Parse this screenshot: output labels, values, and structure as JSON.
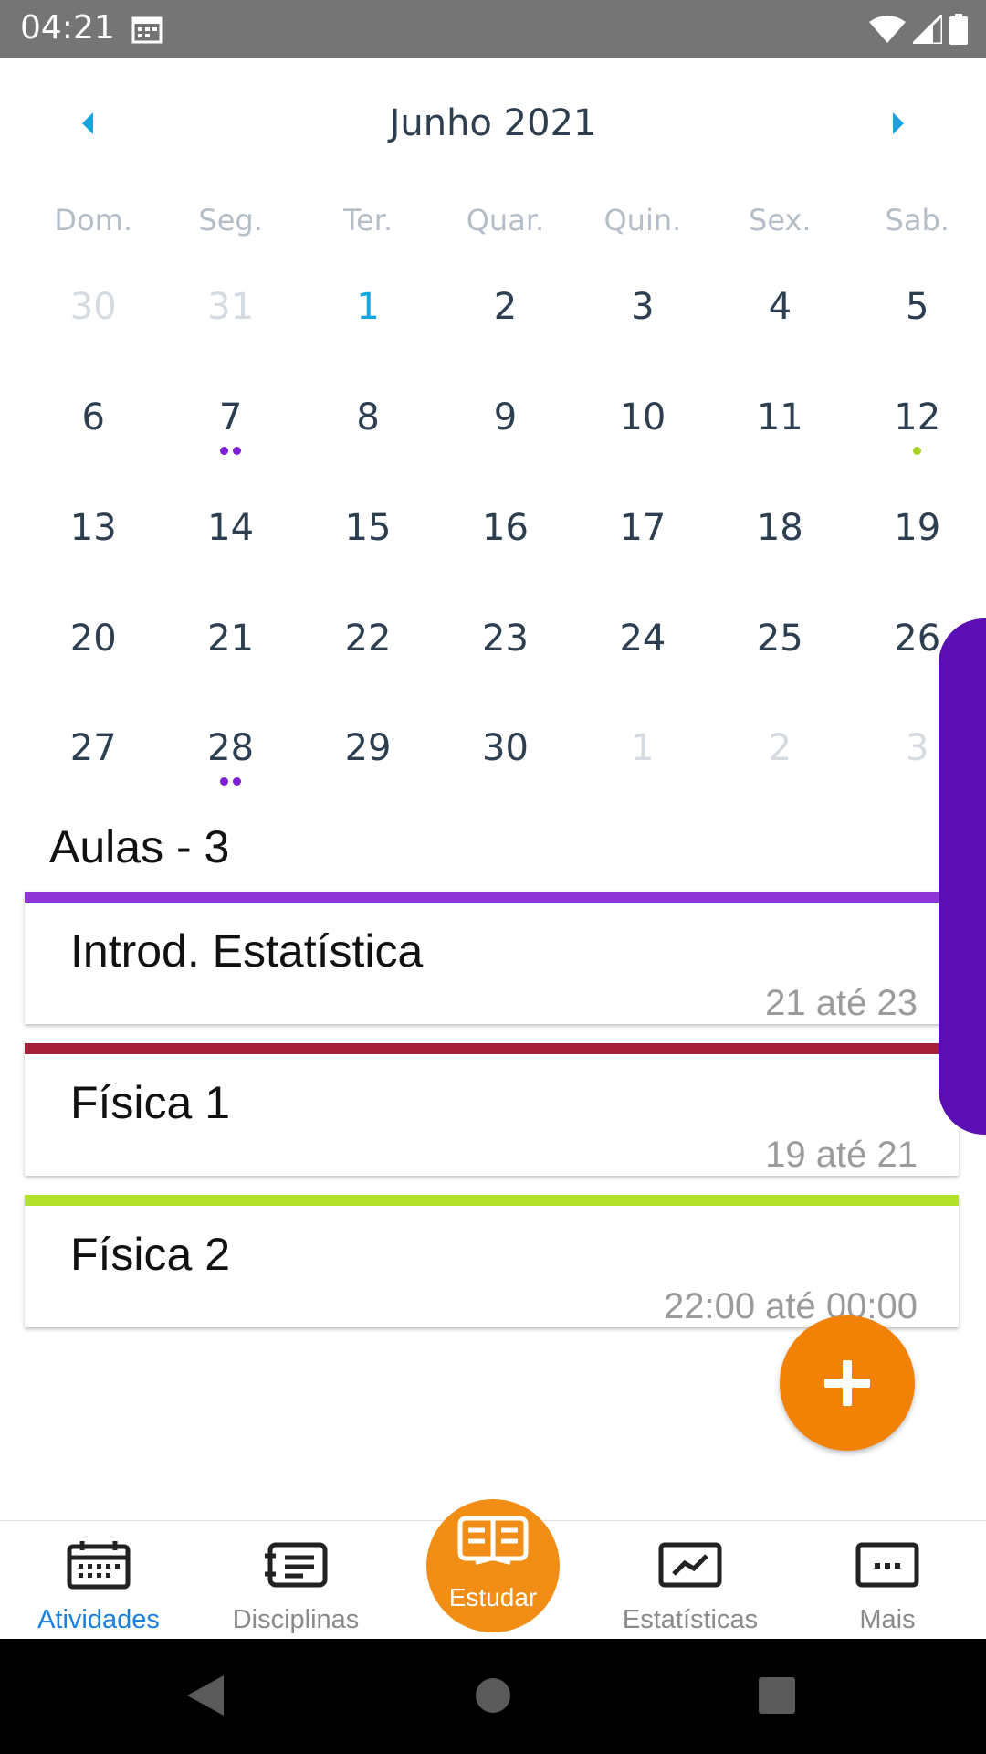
{
  "status_bar": {
    "time": "04:21"
  },
  "calendar": {
    "month_title": "Junho 2021",
    "weekdays": [
      "Dom.",
      "Seg.",
      "Ter.",
      "Quar.",
      "Quin.",
      "Sex.",
      "Sab."
    ],
    "weeks": [
      [
        {
          "n": "30",
          "other": true
        },
        {
          "n": "31",
          "other": true
        },
        {
          "n": "1",
          "today": true
        },
        {
          "n": "2"
        },
        {
          "n": "3"
        },
        {
          "n": "4"
        },
        {
          "n": "5"
        }
      ],
      [
        {
          "n": "6"
        },
        {
          "n": "7",
          "dots": [
            "#7d1fd6",
            "#7d1fd6"
          ]
        },
        {
          "n": "8"
        },
        {
          "n": "9"
        },
        {
          "n": "10"
        },
        {
          "n": "11"
        },
        {
          "n": "12",
          "dots": [
            "#a7d421"
          ]
        }
      ],
      [
        {
          "n": "13"
        },
        {
          "n": "14"
        },
        {
          "n": "15"
        },
        {
          "n": "16"
        },
        {
          "n": "17"
        },
        {
          "n": "18"
        },
        {
          "n": "19"
        }
      ],
      [
        {
          "n": "20"
        },
        {
          "n": "21"
        },
        {
          "n": "22"
        },
        {
          "n": "23"
        },
        {
          "n": "24"
        },
        {
          "n": "25"
        },
        {
          "n": "26"
        }
      ],
      [
        {
          "n": "27"
        },
        {
          "n": "28",
          "dots": [
            "#7d1fd6",
            "#7d1fd6"
          ]
        },
        {
          "n": "29"
        },
        {
          "n": "30"
        },
        {
          "n": "1",
          "other": true
        },
        {
          "n": "2",
          "other": true
        },
        {
          "n": "3",
          "other": true
        }
      ]
    ]
  },
  "classes": {
    "section_title": "Aulas - 3",
    "items": [
      {
        "title": "Introd. Estatística",
        "time": "21 até 23",
        "color": "#8e35d8"
      },
      {
        "title": "Física 1",
        "time": "19 até 21",
        "color": "#a51f3b"
      },
      {
        "title": "Física 2",
        "time": "22:00 até 00:00",
        "color": "#b3e02a"
      }
    ]
  },
  "fab": {
    "icon": "plus-icon"
  },
  "bottom_nav": {
    "items": [
      {
        "label": "Atividades",
        "icon": "calendar-icon",
        "active": true
      },
      {
        "label": "Disciplinas",
        "icon": "list-icon"
      },
      {
        "label": "Estatísticas",
        "icon": "chart-icon"
      },
      {
        "label": "Mais",
        "icon": "more-icon"
      }
    ],
    "study": {
      "label": "Estudar",
      "icon": "book-icon"
    }
  },
  "colors": {
    "accent_orange": "#f28206",
    "side_tab": "#5a0eb4",
    "today_blue": "#1ba3de",
    "active_nav": "#1b7fe0"
  }
}
